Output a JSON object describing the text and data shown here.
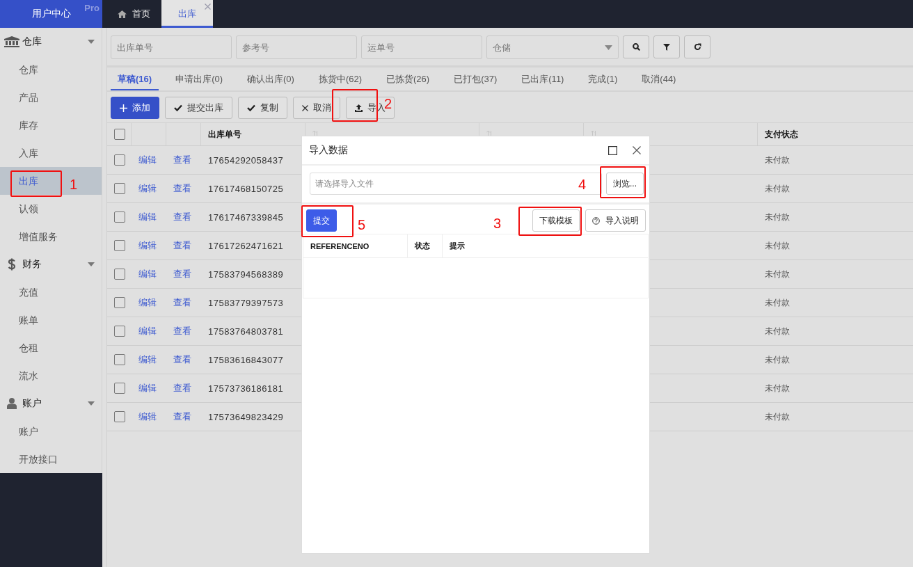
{
  "brand": {
    "title": "用户中心",
    "badge": "Pro"
  },
  "page_tabs": [
    {
      "label": "首页",
      "kind": "home",
      "selected": false,
      "closable": false
    },
    {
      "label": "出库",
      "kind": "plain",
      "selected": true,
      "closable": true
    }
  ],
  "sidebar": {
    "groups": [
      {
        "label": "仓库",
        "expanded": true,
        "items": [
          {
            "label": "仓库",
            "selected": false
          },
          {
            "label": "产品",
            "selected": false
          },
          {
            "label": "库存",
            "selected": false
          },
          {
            "label": "入库",
            "selected": false
          },
          {
            "label": "出库",
            "selected": true
          },
          {
            "label": "认领",
            "selected": false
          },
          {
            "label": "增值服务",
            "selected": false
          }
        ]
      },
      {
        "label": "财务",
        "expanded": true,
        "items": [
          {
            "label": "充值",
            "selected": false
          },
          {
            "label": "账单",
            "selected": false
          },
          {
            "label": "仓租",
            "selected": false
          },
          {
            "label": "流水",
            "selected": false
          }
        ]
      },
      {
        "label": "账户",
        "expanded": true,
        "items": [
          {
            "label": "账户",
            "selected": false
          },
          {
            "label": "开放接口",
            "selected": false
          }
        ]
      }
    ]
  },
  "filters": {
    "fields": [
      {
        "placeholder": "出库单号"
      },
      {
        "placeholder": "参考号"
      },
      {
        "placeholder": "运单号"
      }
    ],
    "select": {
      "placeholder": "仓储"
    },
    "buttons": [
      {
        "kind": "search"
      },
      {
        "kind": "filter"
      },
      {
        "kind": "refresh"
      }
    ]
  },
  "status_tabs": [
    {
      "label": "草稿(16)",
      "selected": true
    },
    {
      "label": "申请出库(0)",
      "selected": false
    },
    {
      "label": "确认出库(0)",
      "selected": false
    },
    {
      "label": "拣货中(62)",
      "selected": false
    },
    {
      "label": "已拣货(26)",
      "selected": false
    },
    {
      "label": "已打包(37)",
      "selected": false
    },
    {
      "label": "已出库(11)",
      "selected": false
    },
    {
      "label": "完成(1)",
      "selected": false
    },
    {
      "label": "取消(44)",
      "selected": false
    }
  ],
  "toolbar": [
    {
      "label": "添加",
      "primary": true
    },
    {
      "label": "提交出库",
      "primary": false
    },
    {
      "label": "复制",
      "primary": false
    },
    {
      "label": "取消",
      "primary": false
    },
    {
      "label": "导入",
      "primary": false
    }
  ],
  "table": {
    "all_checked": false,
    "columns": [
      {
        "kind": "check"
      },
      {
        "kind": "edit"
      },
      {
        "kind": "view"
      },
      {
        "label": "出库单号",
        "kind": "text",
        "sortable": false
      },
      {
        "kind": "text",
        "sortable": true
      },
      {
        "kind": "text",
        "sortable": true
      },
      {
        "kind": "text",
        "sortable": true
      },
      {
        "label": "支付状态",
        "kind": "text",
        "sortable": false
      }
    ],
    "rows": [
      {
        "checked": false,
        "edit": "编辑",
        "view": "查看",
        "order_no": "17654292058437",
        "payment": "未付款"
      },
      {
        "checked": false,
        "edit": "编辑",
        "view": "查看",
        "order_no": "17617468150725",
        "payment": "未付款"
      },
      {
        "checked": false,
        "edit": "编辑",
        "view": "查看",
        "order_no": "17617467339845",
        "payment": "未付款"
      },
      {
        "checked": false,
        "edit": "编辑",
        "view": "查看",
        "order_no": "17617262471621",
        "payment": "未付款"
      },
      {
        "checked": false,
        "edit": "编辑",
        "view": "查看",
        "order_no": "17583794568389",
        "payment": "未付款"
      },
      {
        "checked": false,
        "edit": "编辑",
        "view": "查看",
        "order_no": "17583779397573",
        "payment": "未付款"
      },
      {
        "checked": false,
        "edit": "编辑",
        "view": "查看",
        "order_no": "17583764803781",
        "payment": "未付款"
      },
      {
        "checked": false,
        "edit": "编辑",
        "view": "查看",
        "order_no": "17583616843077",
        "payment": "未付款"
      },
      {
        "checked": false,
        "edit": "编辑",
        "view": "查看",
        "order_no": "17573736186181",
        "payment": "未付款"
      },
      {
        "checked": false,
        "edit": "编辑",
        "view": "查看",
        "order_no": "17573649823429",
        "payment": "未付款"
      }
    ]
  },
  "dialog": {
    "title": "导入数据",
    "file_field": {
      "placeholder": "请选择导入文件"
    },
    "browse_button": "浏览...",
    "submit_button": "提交",
    "template_button": "下载模板",
    "help_button": "导入说明",
    "columns": [
      "REFERENCENO",
      "状态",
      "提示"
    ]
  },
  "annotations": [
    {
      "label": "1"
    },
    {
      "label": "2"
    },
    {
      "label": "3"
    },
    {
      "label": "4"
    },
    {
      "label": "5"
    }
  ]
}
